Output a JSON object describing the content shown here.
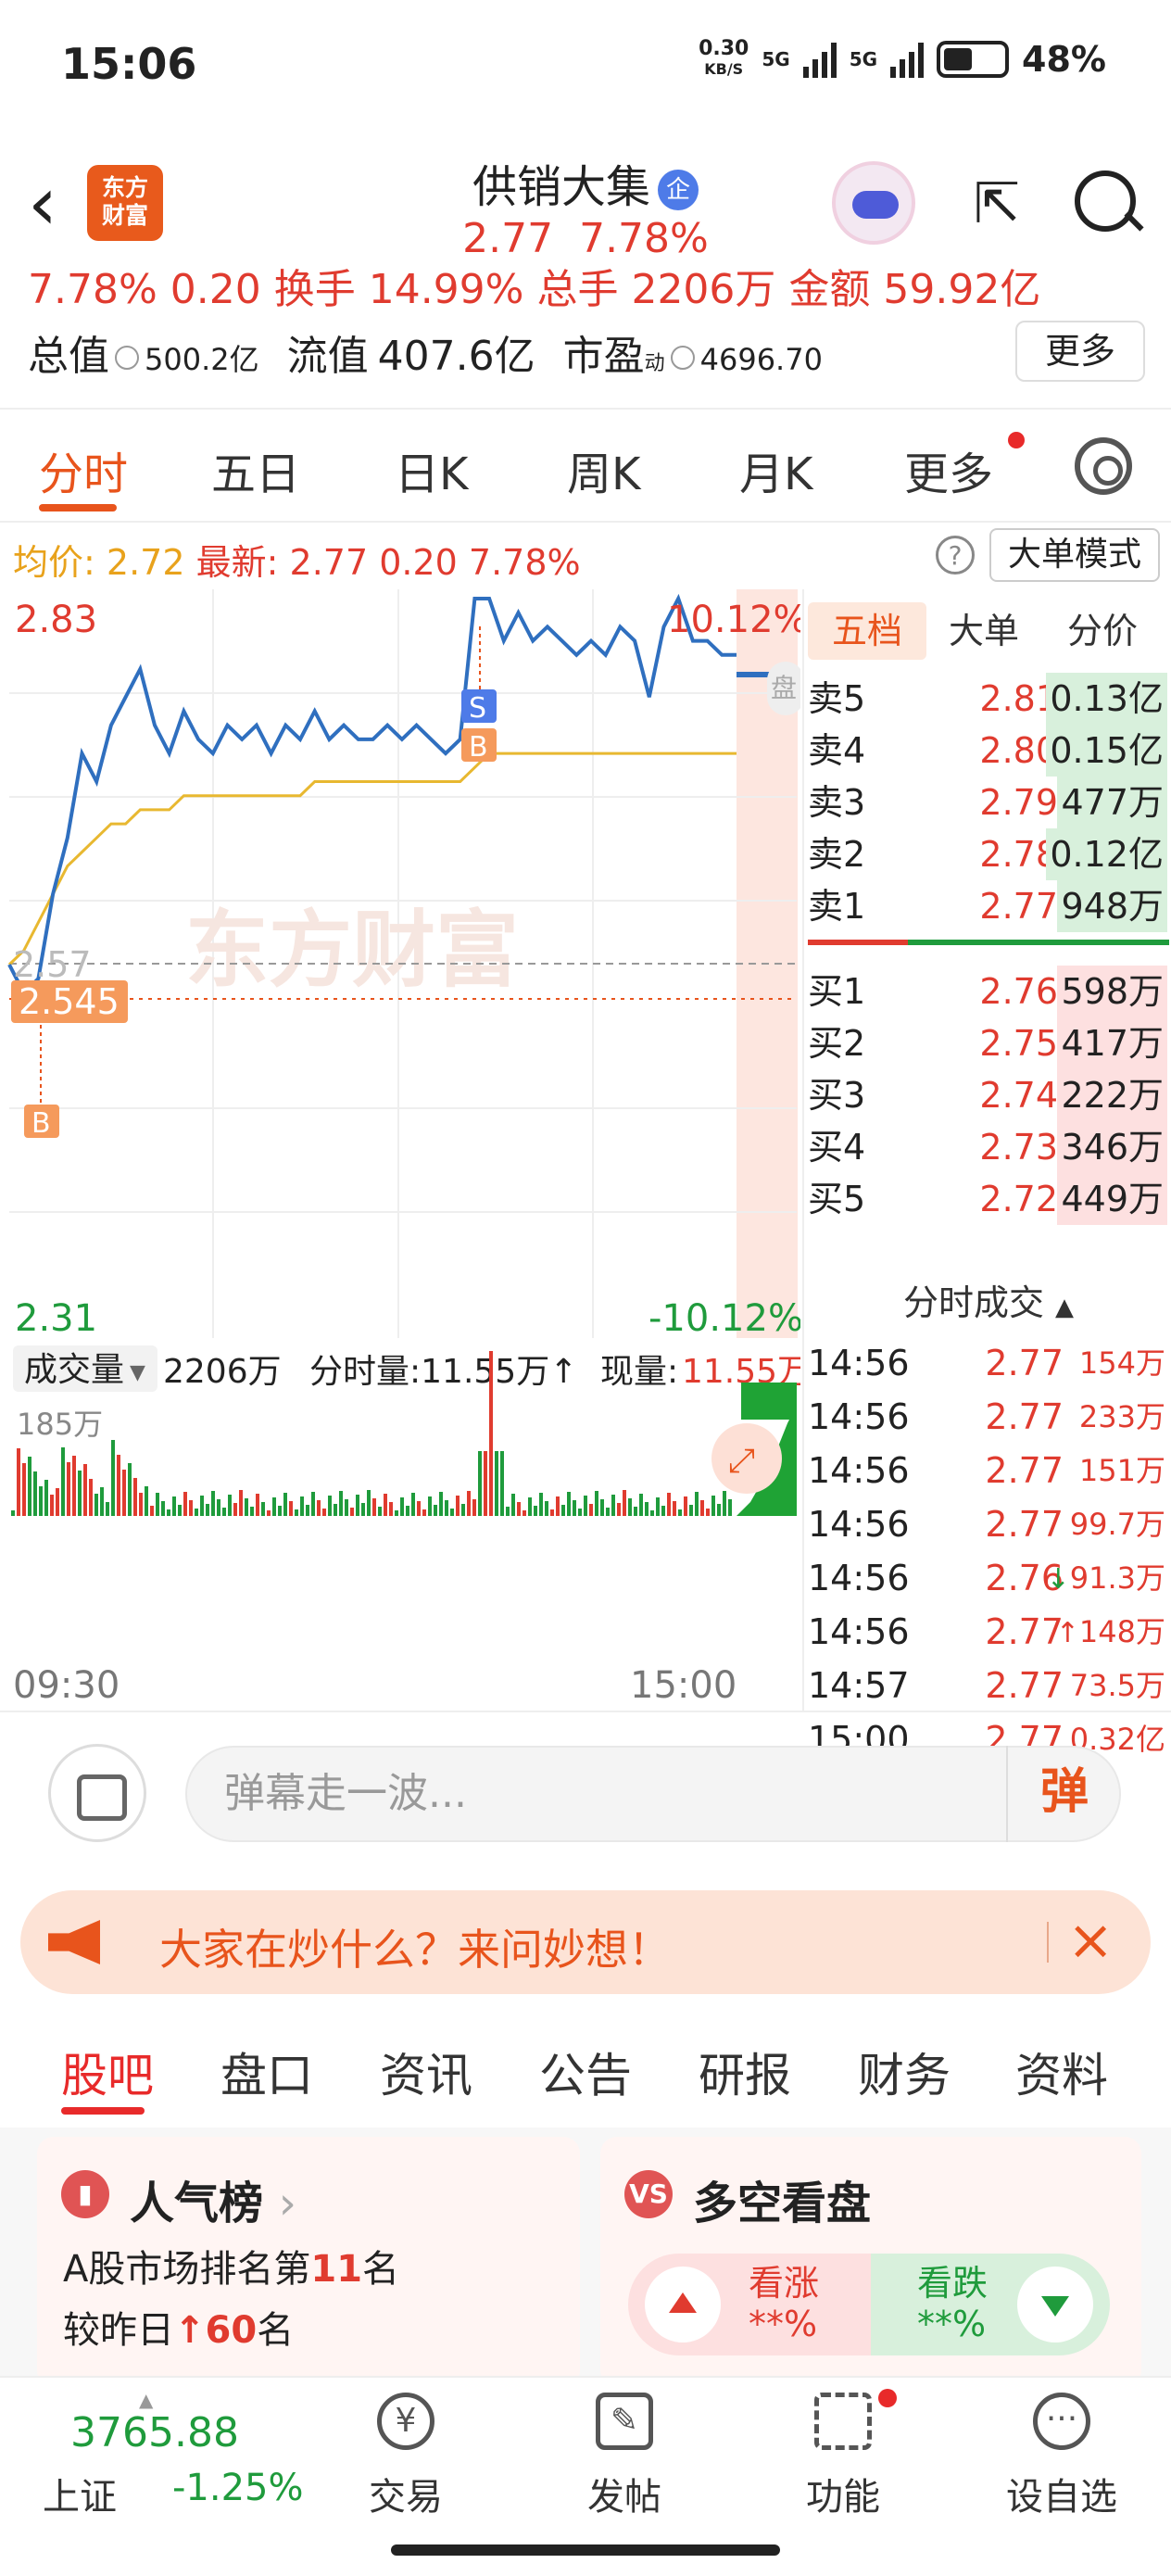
{
  "status_bar": {
    "time": "15:06",
    "net_speed": "0.30",
    "net_unit": "KB/S",
    "net1": "5G",
    "net2": "5G",
    "battery": "48%"
  },
  "header": {
    "logo_line1": "东方",
    "logo_line2": "财富",
    "title": "供销大集",
    "badge": "企",
    "price": "2.77",
    "change_pct": "7.78%"
  },
  "stats": {
    "cut_row": "7.78%   0.20   换手 14.99%  总手 2206万  金额 59.92亿",
    "total_cap_label": "总值",
    "total_cap": "500.2亿",
    "float_cap_label": "流值",
    "float_cap": "407.6亿",
    "pe_label": "市盈",
    "pe_sup": "动",
    "pe": "4696.70",
    "more_button": "更多"
  },
  "tabs": [
    "分时",
    "五日",
    "日K",
    "周K",
    "月K",
    "更多"
  ],
  "avg_line": {
    "avg_label": "均价:",
    "avg": "2.72",
    "latest_label": "最新:",
    "latest": "2.77",
    "change": "0.20",
    "change_pct": "7.78%",
    "mode_button": "大单模式"
  },
  "chart": {
    "y_top": "2.83",
    "y_bottom": "2.31",
    "pct_top": "10.12%",
    "pct_bottom": "-10.12%",
    "prev_close": "2.57",
    "marker_price": "2.545",
    "watermark": "东方财富",
    "marker_b": "B",
    "marker_s": "S",
    "side_tag": "盘",
    "vol_label": "成交量",
    "vol_total": "2206万",
    "vol_period": "分时量:11.55万↑",
    "vol_now_label": "现量:",
    "vol_now": "11.55万",
    "vol_max": "185万",
    "time_start": "09:30",
    "time_end": "15:00"
  },
  "chart_data": {
    "type": "line",
    "title": "",
    "ylim": [
      2.31,
      2.83
    ],
    "x_range": [
      "09:30",
      "15:00"
    ],
    "prev_close": 2.57,
    "series": [
      {
        "values": [
          2.57,
          2.55,
          2.56,
          2.62,
          2.66,
          2.72,
          2.7,
          2.74,
          2.76,
          2.78,
          2.74,
          2.72,
          2.75,
          2.73,
          2.72,
          2.74,
          2.73,
          2.74,
          2.72,
          2.74,
          2.73,
          2.75,
          2.73,
          2.74,
          2.73,
          2.73,
          2.74,
          2.73,
          2.74,
          2.73,
          2.72,
          2.73,
          2.83,
          2.83,
          2.8,
          2.82,
          2.8,
          2.81,
          2.8,
          2.79,
          2.8,
          2.79,
          2.81,
          2.8,
          2.76,
          2.81,
          2.83,
          2.8,
          2.8,
          2.79,
          2.79
        ]
      },
      {
        "values": [
          2.57,
          2.58,
          2.6,
          2.62,
          2.64,
          2.65,
          2.66,
          2.67,
          2.67,
          2.68,
          2.68,
          2.68,
          2.69,
          2.69,
          2.69,
          2.69,
          2.69,
          2.69,
          2.69,
          2.69,
          2.69,
          2.7,
          2.7,
          2.7,
          2.7,
          2.7,
          2.7,
          2.7,
          2.7,
          2.7,
          2.7,
          2.7,
          2.71,
          2.72,
          2.72,
          2.72,
          2.72,
          2.72,
          2.72,
          2.72,
          2.72,
          2.72,
          2.72,
          2.72,
          2.72,
          2.72,
          2.72,
          2.72,
          2.72,
          2.72,
          2.72
        ]
      }
    ]
  },
  "orderbook": {
    "tabs": [
      "五档",
      "大单",
      "分价"
    ],
    "asks": [
      {
        "label": "卖5",
        "price": "2.81",
        "vol": "0.13亿"
      },
      {
        "label": "卖4",
        "price": "2.80",
        "vol": "0.15亿"
      },
      {
        "label": "卖3",
        "price": "2.79",
        "vol": "477万"
      },
      {
        "label": "卖2",
        "price": "2.78",
        "vol": "0.12亿"
      },
      {
        "label": "卖1",
        "price": "2.77",
        "vol": "948万"
      }
    ],
    "bids": [
      {
        "label": "买1",
        "price": "2.76",
        "vol": "598万"
      },
      {
        "label": "买2",
        "price": "2.75",
        "vol": "417万"
      },
      {
        "label": "买3",
        "price": "2.74",
        "vol": "222万"
      },
      {
        "label": "买4",
        "price": "2.73",
        "vol": "346万"
      },
      {
        "label": "买5",
        "price": "2.72",
        "vol": "449万"
      }
    ],
    "trades_title": "分时成交",
    "trades": [
      {
        "time": "14:56",
        "price": "2.77",
        "vol": "154万"
      },
      {
        "time": "14:56",
        "price": "2.77",
        "vol": "233万"
      },
      {
        "time": "14:56",
        "price": "2.77",
        "vol": "151万"
      },
      {
        "time": "14:56",
        "price": "2.77",
        "vol": "99.7万"
      },
      {
        "time": "14:56",
        "price": "2.76",
        "vol": "91.3万",
        "arrow": "↓"
      },
      {
        "time": "14:56",
        "price": "2.77",
        "vol": "148万",
        "arrow": "↑"
      },
      {
        "time": "14:57",
        "price": "2.77",
        "vol": "73.5万"
      },
      {
        "time": "15:00",
        "price": "2.77",
        "vol": "0.32亿"
      }
    ]
  },
  "danmu": {
    "placeholder": "弹幕走一波...",
    "button": "弹"
  },
  "banner": {
    "text": "大家在炒什么？来问妙想！"
  },
  "subtabs": [
    "股吧",
    "盘口",
    "资讯",
    "公告",
    "研报",
    "财务",
    "资料"
  ],
  "cards": {
    "popular": {
      "title": "人气榜",
      "line1_pre": "A股市场排名第",
      "rank": "11",
      "line1_post": "名",
      "line2_pre": "较昨日",
      "change": "60",
      "line2_post": "名"
    },
    "bullbear": {
      "icon": "VS",
      "title": "多空看盘",
      "up_label": "看涨",
      "up_val": "**%",
      "down_label": "看跌",
      "down_val": "**%"
    }
  },
  "bottom_nav": {
    "index_value": "3765.88",
    "index_name": "上证",
    "index_change": "-1.25%",
    "items": [
      "交易",
      "发帖",
      "功能",
      "设自选"
    ]
  }
}
